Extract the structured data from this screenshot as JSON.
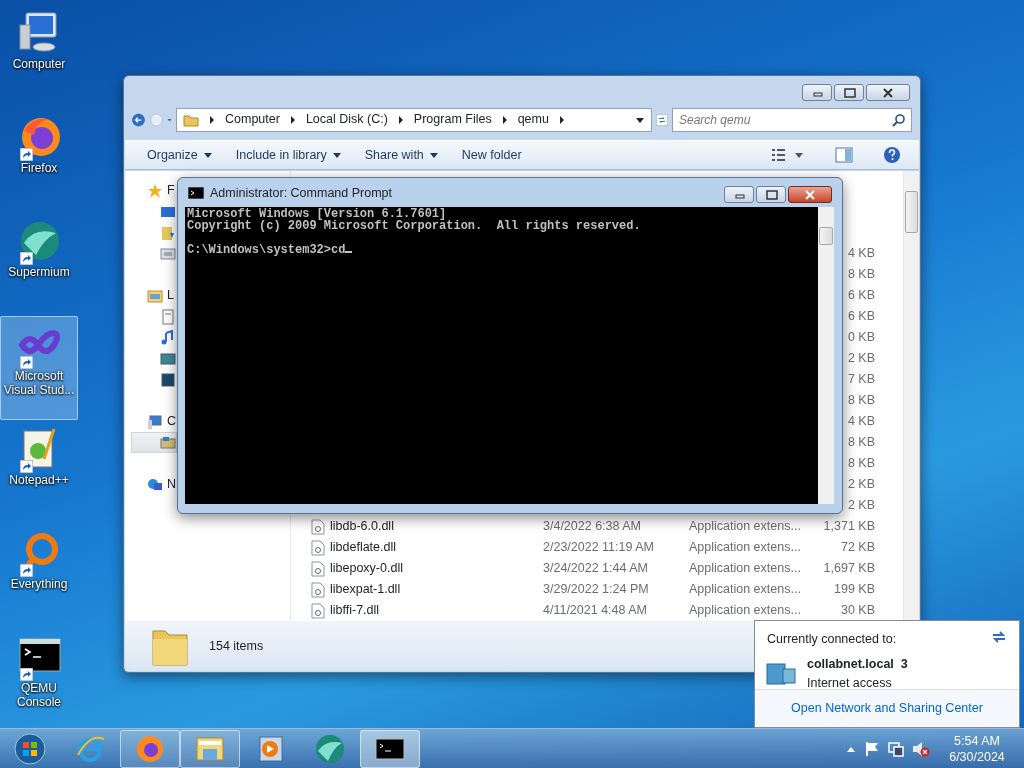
{
  "desktop_icons": [
    {
      "label": "Computer",
      "kind": "computer",
      "shortcut": false,
      "selected": false
    },
    {
      "label": "Firefox",
      "kind": "firefox",
      "shortcut": true,
      "selected": false
    },
    {
      "label": "Supermium",
      "kind": "supermium",
      "shortcut": true,
      "selected": false
    },
    {
      "label": "Microsoft Visual Stud...",
      "kind": "visualstudio",
      "shortcut": true,
      "selected": true
    },
    {
      "label": "Notepad++",
      "kind": "notepad",
      "shortcut": true,
      "selected": false
    },
    {
      "label": "Everything",
      "kind": "everything",
      "shortcut": true,
      "selected": false
    },
    {
      "label": "QEMU Console",
      "kind": "console",
      "shortcut": true,
      "selected": false
    }
  ],
  "explorer": {
    "address": [
      "Computer",
      "Local Disk (C:)",
      "Program Files",
      "qemu"
    ],
    "search": {
      "placeholder": "Search qemu"
    },
    "toolbar": [
      {
        "label": "Organize",
        "dropdown": true
      },
      {
        "label": "Include in library",
        "dropdown": true
      },
      {
        "label": "Share with",
        "dropdown": true
      },
      {
        "label": "New folder",
        "dropdown": false
      }
    ],
    "nav_groups": [
      {
        "label": "F",
        "kind": "favorites",
        "children": [
          {
            "kind": "desktop",
            "selected": false
          },
          {
            "kind": "downloads",
            "selected": false
          },
          {
            "kind": "recent",
            "selected": false
          }
        ]
      },
      {
        "label": "L",
        "kind": "libraries",
        "children": [
          {
            "kind": "documents",
            "selected": false
          },
          {
            "kind": "music",
            "selected": false
          },
          {
            "kind": "pictures",
            "selected": false
          },
          {
            "kind": "videos",
            "selected": false
          }
        ]
      },
      {
        "label": "C",
        "kind": "computer",
        "children": [
          {
            "kind": "disk",
            "selected": true
          }
        ]
      },
      {
        "label": "N",
        "kind": "network"
      }
    ],
    "files": [
      {
        "size": "4 KB"
      },
      {
        "size": "8 KB"
      },
      {
        "size": "6 KB"
      },
      {
        "size": "6 KB"
      },
      {
        "size": "0 KB"
      },
      {
        "size": "2 KB"
      },
      {
        "size": "7 KB"
      },
      {
        "size": "8 KB"
      },
      {
        "size": "4 KB"
      },
      {
        "size": "8 KB"
      },
      {
        "size": "8 KB"
      },
      {
        "size": "2 KB"
      },
      {
        "size": "2 KB"
      },
      {
        "name": "libdb-6.0.dll",
        "date": "3/4/2022 6:38 AM",
        "type": "Application extens...",
        "size": "1,371 KB"
      },
      {
        "name": "libdeflate.dll",
        "date": "2/23/2022 11:19 AM",
        "type": "Application extens...",
        "size": "72 KB"
      },
      {
        "name": "libepoxy-0.dll",
        "date": "3/24/2022 1:44 AM",
        "type": "Application extens...",
        "size": "1,697 KB"
      },
      {
        "name": "libexpat-1.dll",
        "date": "3/29/2022 1:24 PM",
        "type": "Application extens...",
        "size": "199 KB"
      },
      {
        "name": "libffi-7.dll",
        "date": "4/11/2021 4:48 AM",
        "type": "Application extens...",
        "size": "30 KB"
      }
    ],
    "status": "154 items"
  },
  "console": {
    "title": "Administrator: Command Prompt",
    "lines": [
      {
        "text": "Microsoft Windows [Version 6.1.7601]"
      },
      {
        "text": "Copyright (c) 2009 Microsoft Corporation.  All rights reserved."
      },
      {
        "text": "C:\\Windows\\system32>cd",
        "blank_before": true
      }
    ],
    "cursor": true
  },
  "network_popup": {
    "header": "Currently connected to:",
    "network": "collabnet.local  3",
    "access": "Internet access",
    "link": "Open Network and Sharing Center"
  },
  "taskbar": [
    {
      "kind": "start",
      "running": false,
      "selected": false
    },
    {
      "kind": "ie",
      "running": false,
      "selected": false
    },
    {
      "kind": "firefox",
      "running": true,
      "selected": false
    },
    {
      "kind": "explorer",
      "running": true,
      "selected": false
    },
    {
      "kind": "media",
      "running": false,
      "selected": false
    },
    {
      "kind": "supermium",
      "running": false,
      "selected": false
    },
    {
      "kind": "console",
      "running": true,
      "selected": true
    }
  ],
  "tray": {
    "muted": true
  },
  "clock": {
    "time": "5:54 AM",
    "date": "6/30/2024"
  }
}
